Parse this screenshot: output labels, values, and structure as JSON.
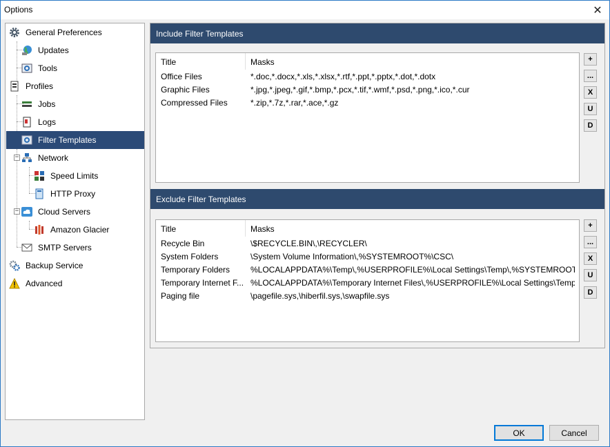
{
  "window": {
    "title": "Options",
    "close_glyph": "✕"
  },
  "tree": {
    "items": [
      {
        "label": "General Preferences",
        "icon": "gear-icon"
      },
      {
        "label": "Updates",
        "icon": "globe-icon"
      },
      {
        "label": "Tools",
        "icon": "tools-icon"
      },
      {
        "label": "Profiles",
        "icon": "profiles-icon"
      },
      {
        "label": "Jobs",
        "icon": "jobs-icon"
      },
      {
        "label": "Logs",
        "icon": "log-icon"
      },
      {
        "label": "Filter Templates",
        "icon": "filter-icon",
        "selected": true
      },
      {
        "label": "Network",
        "icon": "network-icon"
      },
      {
        "label": "Speed Limits",
        "icon": "speed-icon"
      },
      {
        "label": "HTTP Proxy",
        "icon": "proxy-icon"
      },
      {
        "label": "Cloud Servers",
        "icon": "cloud-icon"
      },
      {
        "label": "Amazon Glacier",
        "icon": "amazon-glacier-icon"
      },
      {
        "label": "SMTP Servers",
        "icon": "mail-icon"
      },
      {
        "label": "Backup Service",
        "icon": "service-icon"
      },
      {
        "label": "Advanced",
        "icon": "warning-icon"
      }
    ]
  },
  "include": {
    "header": "Include Filter Templates",
    "columns": {
      "title": "Title",
      "masks": "Masks"
    },
    "rows": [
      {
        "title": "Office Files",
        "masks": "*.doc,*.docx,*.xls,*.xlsx,*.rtf,*.ppt,*.pptx,*.dot,*.dotx"
      },
      {
        "title": "Graphic Files",
        "masks": "*.jpg,*.jpeg,*.gif,*.bmp,*.pcx,*.tif,*.wmf,*.psd,*.png,*.ico,*.cur"
      },
      {
        "title": "Compressed Files",
        "masks": "*.zip,*.7z,*.rar,*.ace,*.gz"
      }
    ]
  },
  "exclude": {
    "header": "Exclude Filter Templates",
    "columns": {
      "title": "Title",
      "masks": "Masks"
    },
    "rows": [
      {
        "title": "Recycle Bin",
        "masks": "\\$RECYCLE.BIN\\,\\RECYCLER\\"
      },
      {
        "title": "System Folders",
        "masks": "\\System Volume Information\\,%SYSTEMROOT%\\CSC\\"
      },
      {
        "title": "Temporary Folders",
        "masks": "%LOCALAPPDATA%\\Temp\\,%USERPROFILE%\\Local Settings\\Temp\\,%SYSTEMROOT%..."
      },
      {
        "title": "Temporary Internet F...",
        "masks": "%LOCALAPPDATA%\\Temporary Internet Files\\,%USERPROFILE%\\Local Settings\\Temp..."
      },
      {
        "title": "Paging file",
        "masks": "\\pagefile.sys,\\hiberfil.sys,\\swapfile.sys"
      }
    ]
  },
  "side_buttons": {
    "add": "+",
    "edit": "...",
    "delete": "X",
    "up": "U",
    "down": "D"
  },
  "buttons": {
    "ok": "OK",
    "cancel": "Cancel"
  },
  "colors": {
    "selection": "#2b4a77",
    "section_header": "#2e4a6e",
    "window_border": "#2b79c6"
  }
}
